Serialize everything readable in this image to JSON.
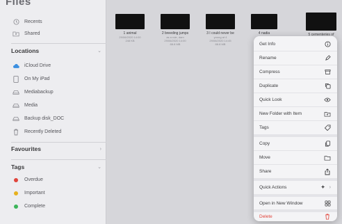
{
  "sidebar": {
    "header": "Files",
    "top_items": [
      {
        "label": "Recents",
        "icon": "clock-icon"
      },
      {
        "label": "Shared",
        "icon": "shared-folder-icon"
      }
    ],
    "locations_title": "Locations",
    "locations": [
      {
        "label": "iCloud Drive",
        "icon": "cloud-icon"
      },
      {
        "label": "On My iPad",
        "icon": "ipad-icon"
      },
      {
        "label": "Mediabackup",
        "icon": "drive-icon"
      },
      {
        "label": "Media",
        "icon": "drive-icon"
      },
      {
        "label": "Backup disk_DOC",
        "icon": "drive-icon"
      },
      {
        "label": "Recently Deleted",
        "icon": "trash-icon"
      }
    ],
    "favourites_title": "Favourites",
    "tags_title": "Tags",
    "tags": [
      {
        "label": "Overdue",
        "color": "#e0443b"
      },
      {
        "label": "Important",
        "color": "#e6b11e"
      },
      {
        "label": "Complete",
        "color": "#3cb55a"
      }
    ]
  },
  "files": [
    {
      "name": "1 animal",
      "meta": [
        "29/06/2020 14:00",
        "248 KB"
      ]
    },
    {
      "name": "2 breeding jumps",
      "meta": [
        "as a rule, dam",
        "29/06/2020 14:00",
        "88.8 MB"
      ]
    },
    {
      "name": "3 I could never be",
      "meta": [
        "young at 4",
        "29/06/2020 14:45",
        "88.8 MB"
      ]
    },
    {
      "name": "4 nadia",
      "meta": []
    },
    {
      "name": "5 cementeries of",
      "meta": []
    }
  ],
  "context_menu": {
    "group1": [
      {
        "label": "Get Info",
        "icon": "info-icon"
      },
      {
        "label": "Rename",
        "icon": "pencil-icon"
      },
      {
        "label": "Compress",
        "icon": "archive-icon"
      },
      {
        "label": "Duplicate",
        "icon": "duplicate-icon"
      },
      {
        "label": "Quick Look",
        "icon": "eye-icon"
      },
      {
        "label": "New Folder with Item",
        "icon": "folder-plus-icon"
      },
      {
        "label": "Tags",
        "icon": "tag-icon"
      }
    ],
    "group2": [
      {
        "label": "Copy",
        "icon": "copy-icon"
      },
      {
        "label": "Move",
        "icon": "folder-icon"
      },
      {
        "label": "Share",
        "icon": "share-icon"
      }
    ],
    "quick_actions": {
      "label": "Quick Actions",
      "icon": "sparkle-icon",
      "chevron": "›"
    },
    "open_new_window": {
      "label": "Open in New Window",
      "icon": "window-grid-icon"
    },
    "delete": {
      "label": "Delete",
      "icon": "trash-icon",
      "color": "#e0443b"
    }
  }
}
